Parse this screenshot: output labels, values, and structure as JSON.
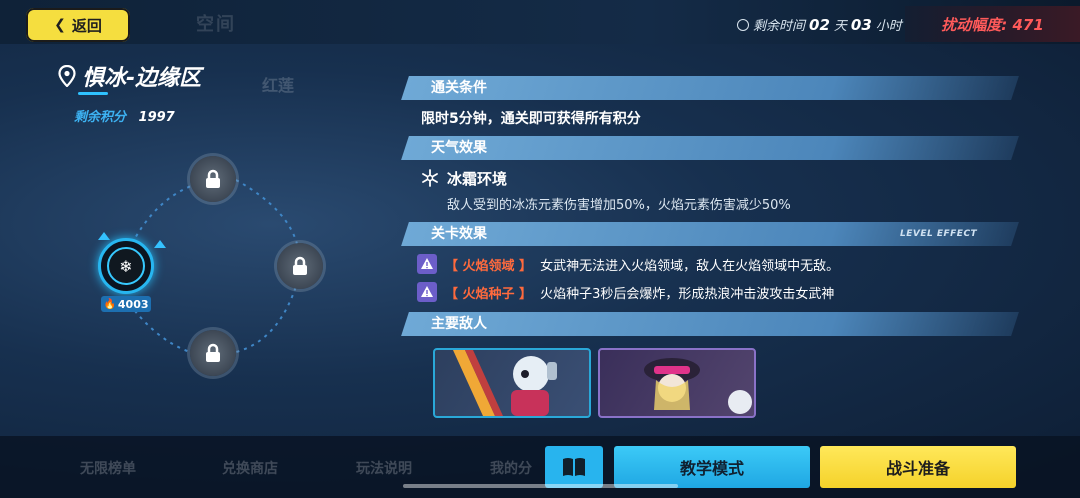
{
  "header": {
    "back_label": "返回",
    "bg_tab_text": "空间",
    "timer": {
      "prefix": "剩余时间",
      "days": "02",
      "days_unit": "天",
      "hours": "03",
      "hours_unit": "小时"
    },
    "disturbance": "扰动幅度: 471"
  },
  "left": {
    "location_name": "惧冰-边缘区",
    "points_label": "剩余积分",
    "points_value": "1997",
    "bg_label_red": "红莲",
    "node_score": "4003",
    "bg_menu": [
      "无限榜单",
      "兑换商店",
      "玩法说明",
      "我的分"
    ]
  },
  "details": {
    "clear_condition_header": "通关条件",
    "clear_condition_text": "限时5分钟，通关即可获得所有积分",
    "weather_header": "天气效果",
    "weather_name": "冰霜环境",
    "weather_desc": "敌人受到的冰冻元素伤害增加50%，火焰元素伤害减少50%",
    "level_effect_header": "关卡效果",
    "level_effect_tag": "LEVEL EFFECT",
    "effects": [
      {
        "tag": "【 火焰领域 】",
        "text": "女武神无法进入火焰领域，敌人在火焰领域中无敌。"
      },
      {
        "tag": "【 火焰种子 】",
        "text": "火焰种子3秒后会爆炸，形成热浪冲击波攻击女武神"
      }
    ],
    "enemies_header": "主要敌人"
  },
  "actions": {
    "tutorial_label": "教学模式",
    "battle_label": "战斗准备"
  },
  "colors": {
    "accent_blue": "#28b4ee",
    "accent_yellow": "#f5de3f",
    "warning_red": "#ff5a5a",
    "effect_orange": "#ff6a3d"
  }
}
